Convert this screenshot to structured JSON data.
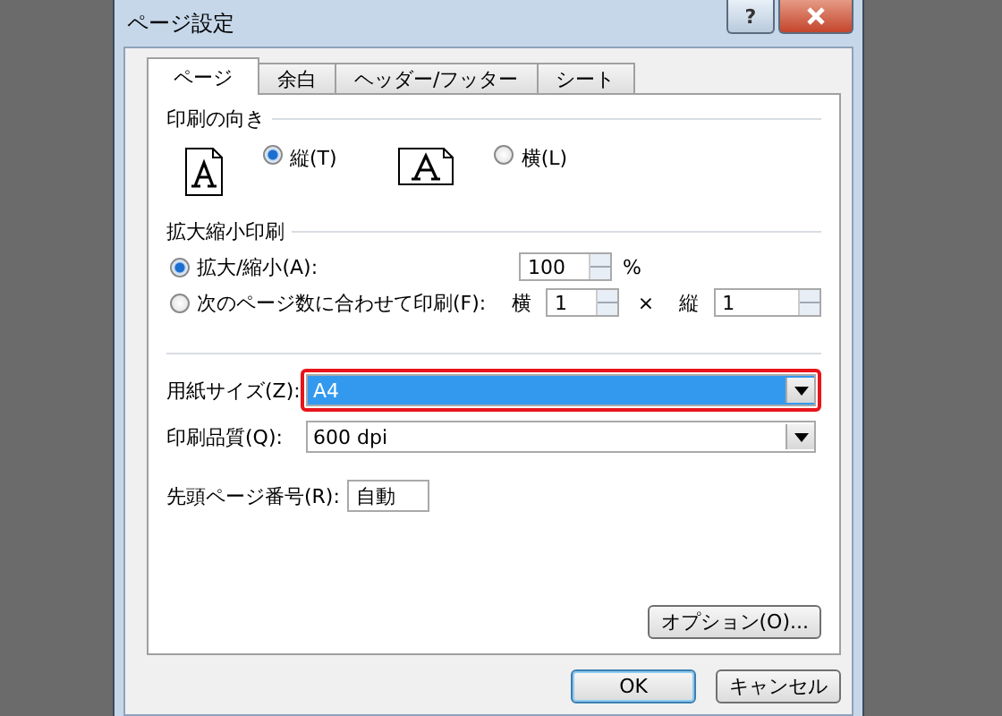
{
  "window": {
    "title": "ページ設定",
    "help_label": "?"
  },
  "tabs": [
    {
      "label": "ページ",
      "selected": true
    },
    {
      "label": "余白",
      "selected": false
    },
    {
      "label": "ヘッダー/フッター",
      "selected": false
    },
    {
      "label": "シート",
      "selected": false
    }
  ],
  "orientation": {
    "title": "印刷の向き",
    "options": [
      {
        "kind": "portrait",
        "label": "縦(T)",
        "selected": true
      },
      {
        "kind": "landscape",
        "label": "横(L)",
        "selected": false
      }
    ]
  },
  "scaling": {
    "title": "拡大縮小印刷",
    "options": [
      {
        "kind": "percent",
        "label": "拡大/縮小(A):",
        "selected": true,
        "value": "100",
        "unit": "%"
      },
      {
        "kind": "fit",
        "label": "次のページ数に合わせて印刷(F):",
        "selected": false,
        "wide_label": "横",
        "wide_value": "1",
        "times": "×",
        "tall_label": "縦",
        "tall_value": "1"
      }
    ]
  },
  "selects": [
    {
      "label": "用紙サイズ(Z):",
      "value": "A4",
      "highlighted": true
    },
    {
      "label": "印刷品質(Q):",
      "value": "600 dpi",
      "highlighted": false
    }
  ],
  "first_page_number": {
    "label": "先頭ページ番号(R):",
    "value": "自動"
  },
  "options_button": "オプション(O)...",
  "buttons": [
    {
      "label": "OK",
      "default": true
    },
    {
      "label": "キャンセル",
      "default": false
    }
  ]
}
